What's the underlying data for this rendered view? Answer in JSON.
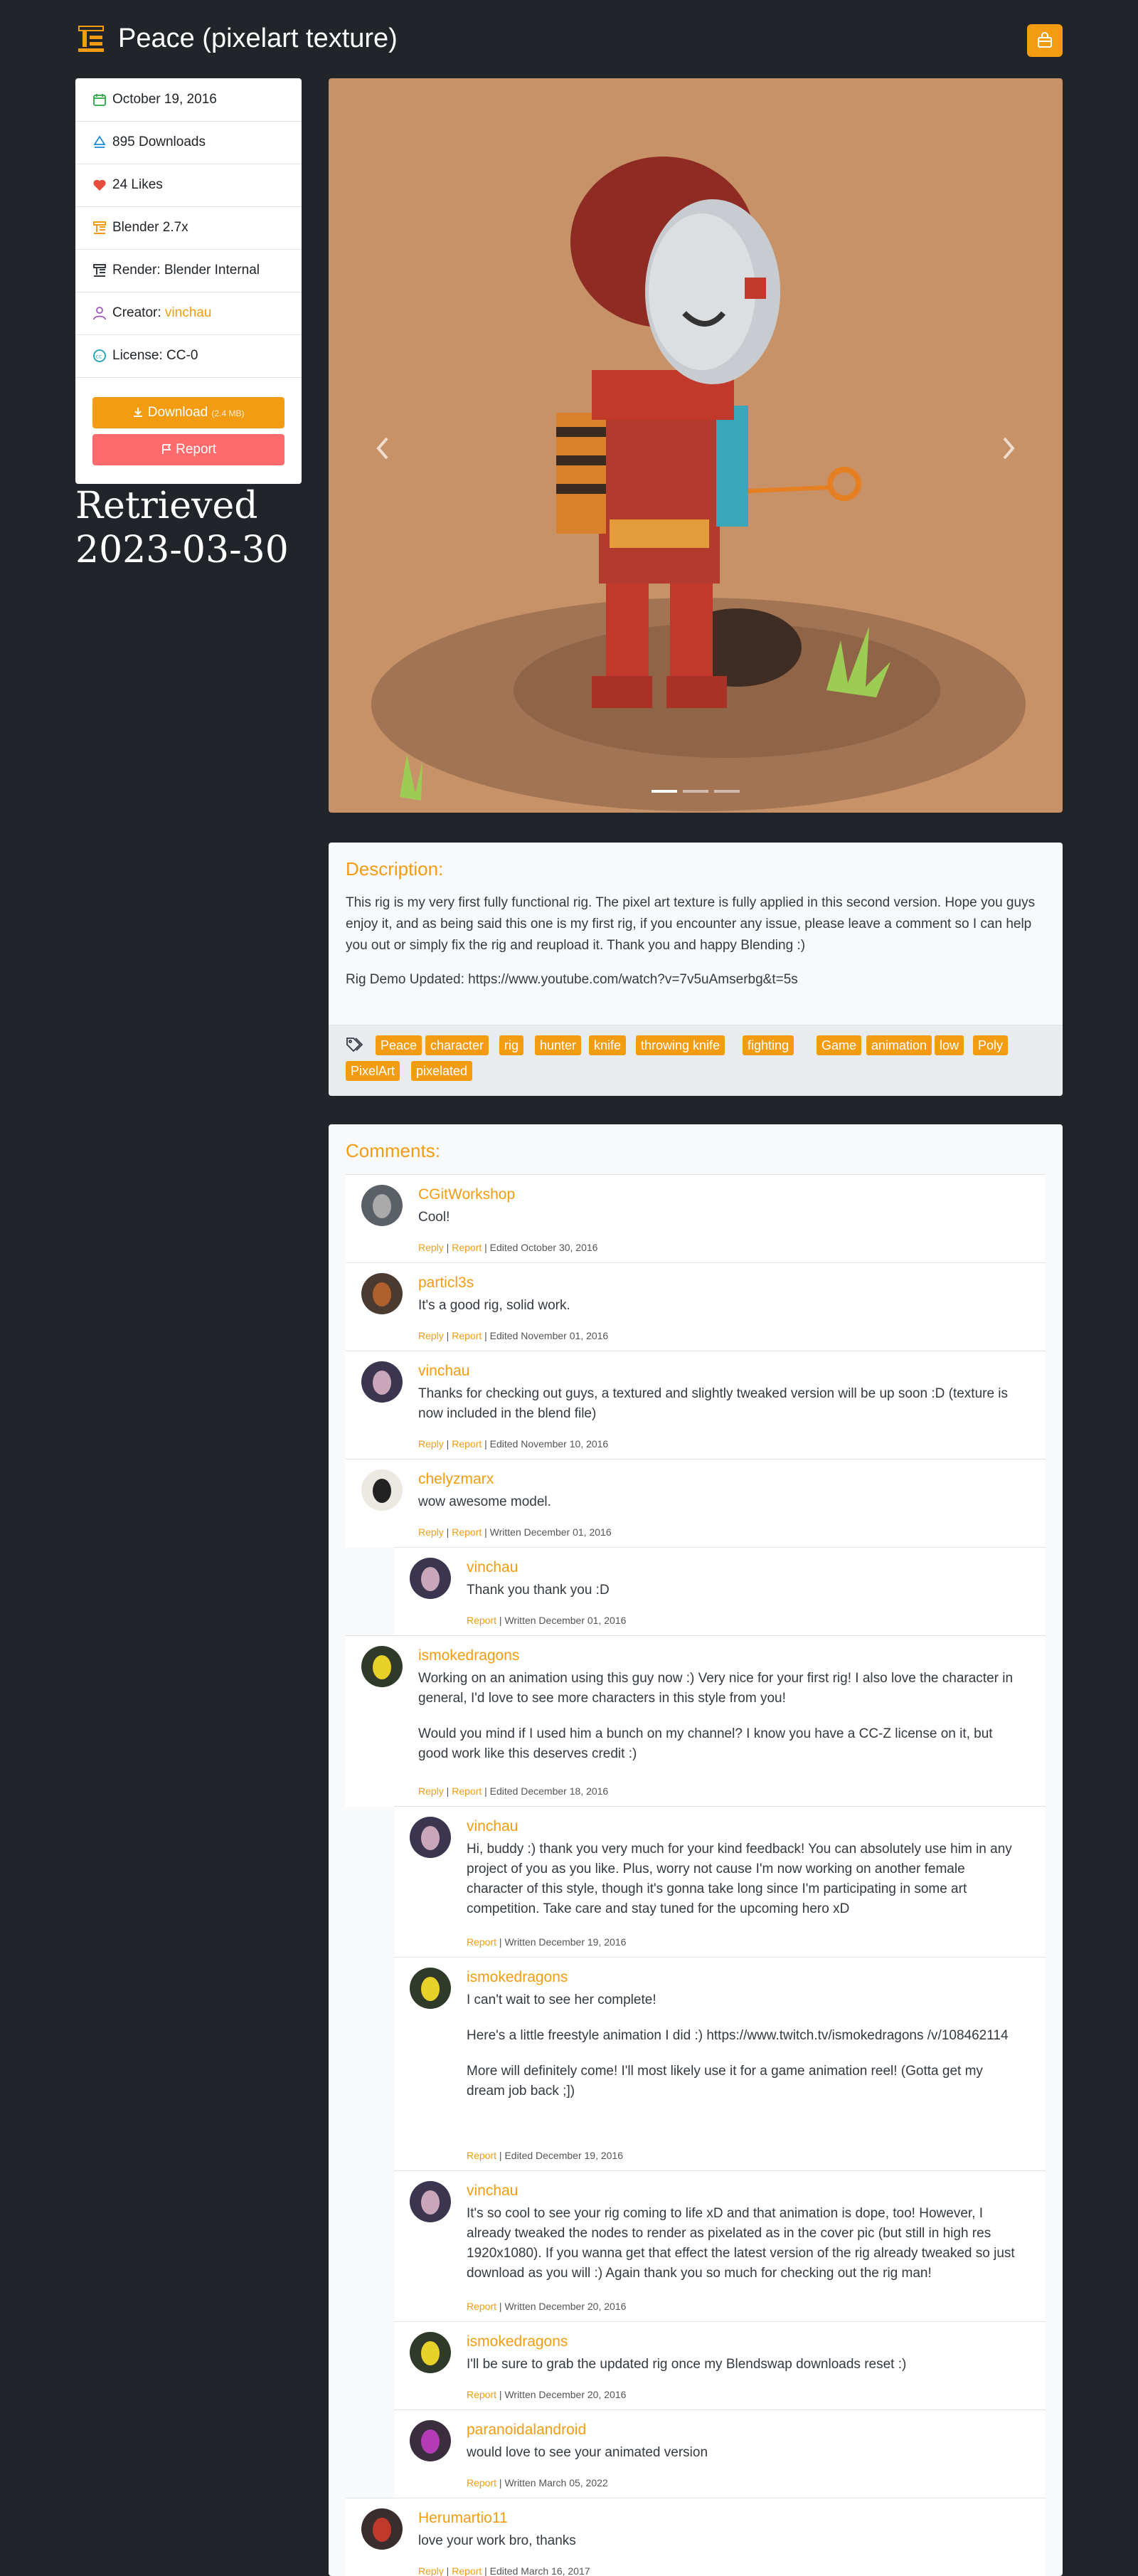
{
  "header": {
    "title": "Peace (pixelart texture)"
  },
  "sidebar": {
    "date": "October 19, 2016",
    "downloads": "895 Downloads",
    "likes": "24 Likes",
    "blender": "Blender 2.7x",
    "render": "Render: Blender Internal",
    "creator_label": "Creator: ",
    "creator_name": "vinchau",
    "license": "License: CC-0",
    "download_label": "Download",
    "download_size": "(2.4 MB)",
    "report_label": "Report"
  },
  "retrieved": "Retrieved 2023-03-30",
  "description": {
    "heading": "Description:",
    "text": "This rig is my very first fully functional rig. The pixel art texture is fully applied in this second version. Hope you guys enjoy it, and as being said this one is my first rig, if you encounter any issue, please leave a comment so I can help you out or simply fix the rig and reupload it. Thank you and happy Blending :)",
    "demo": "Rig Demo Updated: https://www.youtube.com/watch?v=7v5uAmserbg&t=5s",
    "tags": [
      "Peace",
      "character",
      "rig",
      "hunter",
      "knife",
      "throwing knife",
      "fighting",
      "Game",
      "animation",
      "low",
      "Poly",
      "PixelArt",
      "pixelated"
    ]
  },
  "comments": {
    "heading": "Comments:",
    "reply_label": "Reply",
    "report_label": "Report",
    "items": [
      {
        "author": "CGitWorkshop",
        "text": [
          "Cool!"
        ],
        "meta": " | Edited October 30, 2016"
      },
      {
        "author": "particl3s",
        "text": [
          "It's a good rig, solid work."
        ],
        "meta": " | Edited November 01, 2016"
      },
      {
        "author": "vinchau",
        "text": [
          "Thanks for checking out guys, a textured and slightly tweaked version will be up soon :D (texture is now included in the blend file)"
        ],
        "meta": " | Edited November 10, 2016"
      },
      {
        "author": "chelyzmarx",
        "text": [
          "wow awesome model."
        ],
        "meta": " | Written December 01, 2016"
      },
      {
        "author": "vinchau",
        "text": [
          "Thank you thank you :D"
        ],
        "meta": " | Written December 01, 2016"
      },
      {
        "author": "ismokedragons",
        "text": [
          "Working on an animation using this guy now :) Very nice for your first rig! I also love the character in general, I'd love to see more characters in this style from you!",
          "Would you mind if I used him a bunch on my channel? I know you have a CC-Z license on it, but good work like this deserves credit :)"
        ],
        "meta": " | Edited December 18, 2016"
      },
      {
        "author": "vinchau",
        "text": [
          "Hi, buddy :) thank you very much for your kind feedback! You can absolutely use him in any project of you as you like. Plus, worry not cause I'm now working on another female character of this style, though it's gonna take long since I'm participating in some art competition. Take care and stay tuned for the upcoming hero xD"
        ],
        "meta": " | Written December 19, 2016"
      },
      {
        "author": "ismokedragons",
        "text": [
          "I can't wait to see her complete!",
          "Here's a little freestyle animation I did :) https://www.twitch.tv/ismokedragons /v/108462114",
          "More will definitely come! I'll most likely use it for a game animation reel! (Gotta get my dream job back ;])"
        ],
        "meta": " | Edited December 19, 2016"
      },
      {
        "author": "vinchau",
        "text": [
          "It's so cool to see your rig coming to life xD and that animation is dope, too! However, I already tweaked the nodes to render as pixelated as in the cover pic (but still in high res 1920x1080). If you wanna get that effect the latest version of the rig already tweaked so just download as you will :) Again thank you so much for checking out the rig man!"
        ],
        "meta": " | Written December 20, 2016"
      },
      {
        "author": "ismokedragons",
        "text": [
          "I'll be sure to grab the updated rig once my Blendswap downloads reset :)"
        ],
        "meta": " | Written December 20, 2016"
      },
      {
        "author": "paranoidalandroid",
        "text": [
          "would love to see your animated version"
        ],
        "meta": " | Written March 05, 2022"
      },
      {
        "author": "Herumartio11",
        "text": [
          "love your work bro, thanks"
        ],
        "meta": " | Edited March 16, 2017"
      }
    ]
  },
  "colors": {
    "accent": "#f39c12",
    "report": "#ff6b6b",
    "background": "#212529"
  }
}
